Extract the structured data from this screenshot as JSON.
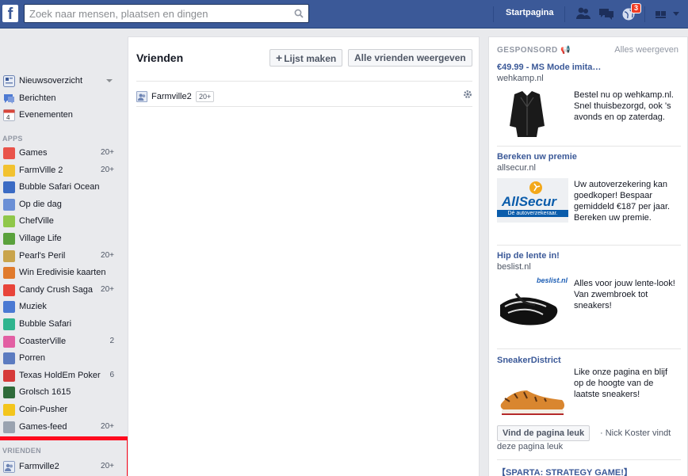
{
  "topbar": {
    "logo": "f",
    "search_placeholder": "Zoek naar mensen, plaatsen en dingen",
    "home_label": "Startpagina",
    "notification_count": "3"
  },
  "sidebar": {
    "top_items": [
      {
        "label": "Nieuwsoverzicht",
        "icon": "news-feed-icon"
      },
      {
        "label": "Berichten",
        "icon": "messages-icon"
      },
      {
        "label": "Evenementen",
        "icon": "calendar-icon",
        "icon_text": "4"
      }
    ],
    "apps_header": "APPS",
    "apps": [
      {
        "label": "Games",
        "count": "20+",
        "color": "#e9534a"
      },
      {
        "label": "FarmVille 2",
        "count": "20+",
        "color": "#f2c230"
      },
      {
        "label": "Bubble Safari Ocean",
        "count": "",
        "color": "#3b6bc4"
      },
      {
        "label": "Op die dag",
        "count": "",
        "color": "#6a8fd6"
      },
      {
        "label": "ChefVille",
        "count": "",
        "color": "#8fc74a"
      },
      {
        "label": "Village Life",
        "count": "",
        "color": "#5aa13c"
      },
      {
        "label": "Pearl's Peril",
        "count": "20+",
        "color": "#c9a44c"
      },
      {
        "label": "Win Eredivisie kaarten",
        "count": "",
        "color": "#e07a2d"
      },
      {
        "label": "Candy Crush Saga",
        "count": "20+",
        "color": "#e8443a"
      },
      {
        "label": "Muziek",
        "count": "",
        "color": "#4a79d3"
      },
      {
        "label": "Bubble Safari",
        "count": "",
        "color": "#2fb48e"
      },
      {
        "label": "CoasterVille",
        "count": "2",
        "color": "#e25fa3"
      },
      {
        "label": "Porren",
        "count": "",
        "color": "#5b7bc0"
      },
      {
        "label": "Texas HoldEm Poker",
        "count": "6",
        "color": "#d63a3a"
      },
      {
        "label": "Grolsch 1615",
        "count": "",
        "color": "#2e6b3a"
      },
      {
        "label": "Coin-Pusher",
        "count": "",
        "color": "#f3c51c"
      },
      {
        "label": "Games-feed",
        "count": "20+",
        "color": "#9aa3b0"
      }
    ],
    "friends_header": "VRIENDEN",
    "friends": [
      {
        "label": "Farmville2",
        "count": "20+"
      }
    ]
  },
  "main": {
    "title": "Vrienden",
    "create_list_label": "Lijst maken",
    "view_all_label": "Alle vrienden weergeven",
    "rows": [
      {
        "label": "Farmville2",
        "count": "20+"
      }
    ]
  },
  "ads": {
    "header": "GESPONSORD",
    "view_all": "Alles weergeven",
    "items": [
      {
        "title": "€49.99 - MS Mode imita…",
        "domain": "wehkamp.nl",
        "text": "Bestel nu op wehkamp.nl. Snel thuisbezorgd, ook 's avonds en op zaterdag.",
        "image": "leather-jacket"
      },
      {
        "title": "Bereken uw premie",
        "domain": "allsecur.nl",
        "text": "Uw autoverzekering kan goedkoper! Bespaar gemiddeld €187 per jaar. Bereken uw premie.",
        "image": "allsecur-logo",
        "logo_text": "AllSecur",
        "logo_sub": "Dé autoverzekeraar."
      },
      {
        "title": "Hip de lente in!",
        "domain": "beslist.nl",
        "text": "Alles voor jouw lente-look! Van zwembroek tot sneakers!",
        "image": "flip-flop",
        "logo_text": "beslist.nl"
      },
      {
        "title": "SneakerDistrict",
        "domain": "",
        "text": "Like onze pagina en blijf op de hoogte van de laatste sneakers!",
        "image": "sneaker",
        "like_button": "Vind de pagina leuk",
        "like_note": "· Nick Koster vindt deze pagina leuk"
      },
      {
        "title": "【SPARTA: STRATEGY GAME!】",
        "domain": "",
        "text": "",
        "image": ""
      }
    ]
  },
  "colors": {
    "brand": "#3b5998",
    "highlight_box": "#ff0a1e"
  }
}
